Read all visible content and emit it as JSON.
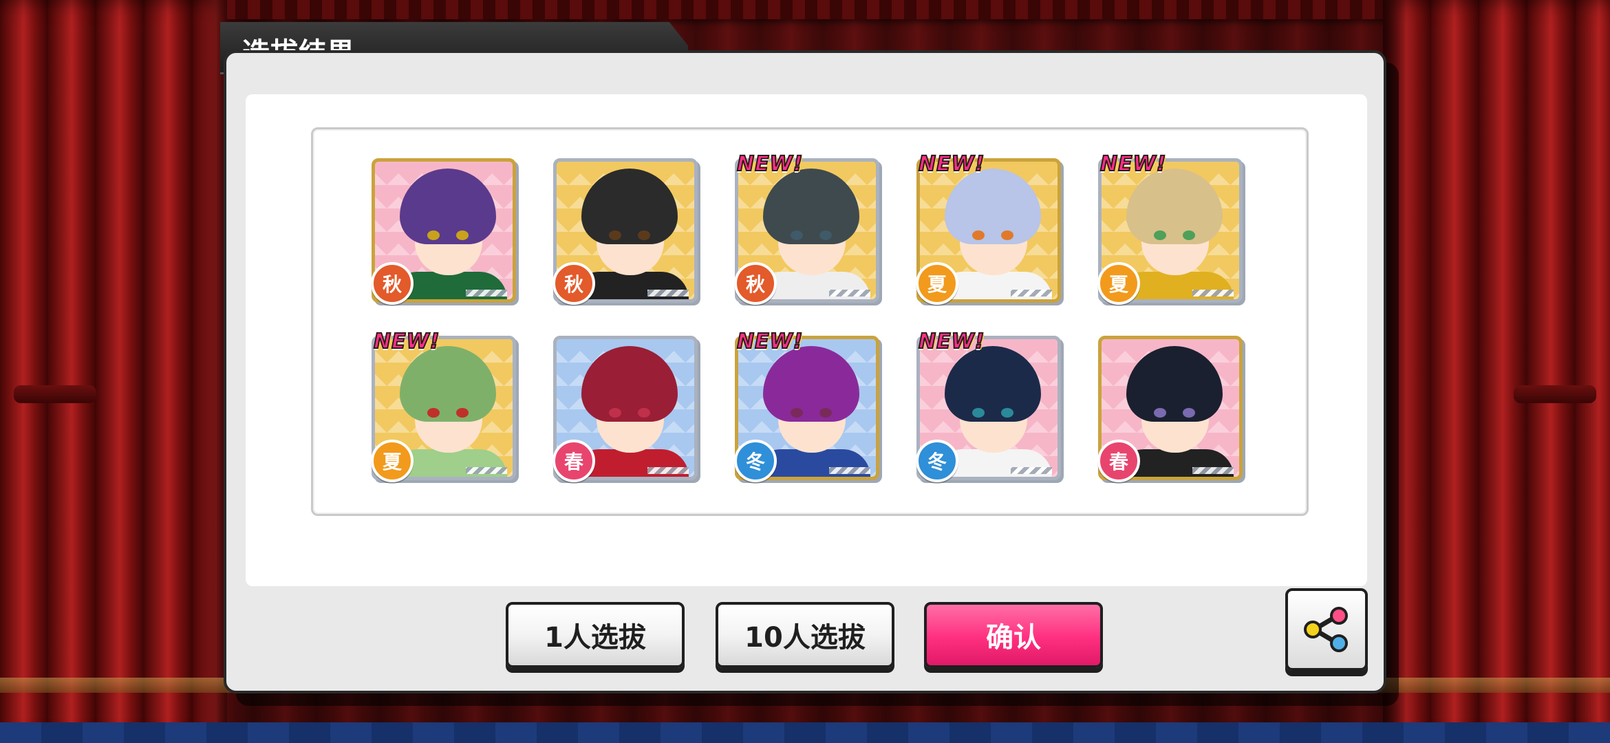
{
  "dialog": {
    "title": "选拔结果"
  },
  "cards": [
    {
      "season": "秋",
      "season_color": "#e35a2b",
      "is_new": false,
      "new_label": "",
      "bg": "#f7b6c8",
      "frame": "gold",
      "hair": "#5a3a8c",
      "eyes": "#c9a21c",
      "outfit": "#1f6b3a"
    },
    {
      "season": "秋",
      "season_color": "#e35a2b",
      "is_new": false,
      "new_label": "",
      "bg": "#f2c960",
      "frame": "silver",
      "hair": "#2b2b2b",
      "eyes": "#5b3a1c",
      "outfit": "#222222"
    },
    {
      "season": "秋",
      "season_color": "#e35a2b",
      "is_new": true,
      "new_label": "NEW!",
      "bg": "#f2c960",
      "frame": "silver",
      "hair": "#3f4a4e",
      "eyes": "#3f5a68",
      "outfit": "#eeeeee"
    },
    {
      "season": "夏",
      "season_color": "#f29a1c",
      "is_new": true,
      "new_label": "NEW!",
      "bg": "#f2c960",
      "frame": "gold",
      "hair": "#b8c4e8",
      "eyes": "#e07a2a",
      "outfit": "#f4f4f4"
    },
    {
      "season": "夏",
      "season_color": "#f29a1c",
      "is_new": true,
      "new_label": "NEW!",
      "bg": "#f2c960",
      "frame": "silver",
      "hair": "#d8c08a",
      "eyes": "#4fa05a",
      "outfit": "#e0b020"
    },
    {
      "season": "夏",
      "season_color": "#f29a1c",
      "is_new": true,
      "new_label": "NEW!",
      "bg": "#f2c960",
      "frame": "silver",
      "hair": "#7fb06a",
      "eyes": "#c0302a",
      "outfit": "#9fcf8a"
    },
    {
      "season": "春",
      "season_color": "#e8456e",
      "is_new": false,
      "new_label": "",
      "bg": "#a8c8f0",
      "frame": "silver",
      "hair": "#9a1e36",
      "eyes": "#c0304a",
      "outfit": "#c01e2e"
    },
    {
      "season": "冬",
      "season_color": "#2f8fd8",
      "is_new": true,
      "new_label": "NEW!",
      "bg": "#a8c8f0",
      "frame": "gold",
      "hair": "#8a2a9a",
      "eyes": "#7a2a5a",
      "outfit": "#2a4aa0"
    },
    {
      "season": "冬",
      "season_color": "#2f8fd8",
      "is_new": true,
      "new_label": "NEW!",
      "bg": "#f7b6c8",
      "frame": "silver",
      "hair": "#1c2a4a",
      "eyes": "#2a8a9a",
      "outfit": "#f4f4f4"
    },
    {
      "season": "春",
      "season_color": "#e8456e",
      "is_new": false,
      "new_label": "",
      "bg": "#f7b6c8",
      "frame": "gold",
      "hair": "#1a2030",
      "eyes": "#7a6ab0",
      "outfit": "#222222"
    }
  ],
  "buttons": {
    "single_draw": "1人选拔",
    "ten_draw": "10人选拔",
    "confirm": "确认",
    "share_icon": "share-icon"
  },
  "colors": {
    "confirm_pink": "#ff2f7f",
    "curtain_red": "#8a1616",
    "new_badge": "#ff2f8a"
  }
}
